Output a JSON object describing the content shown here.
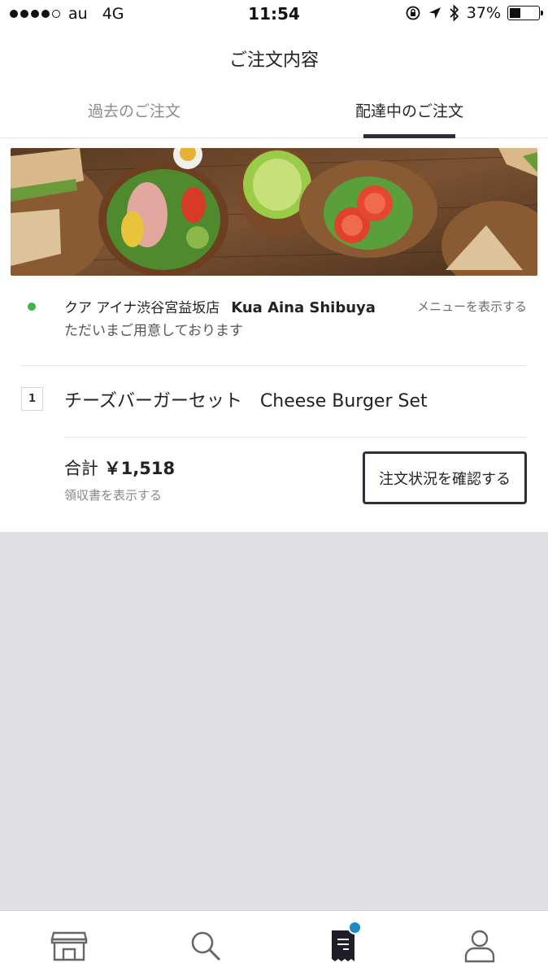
{
  "status_bar": {
    "carrier": "au",
    "network": "4G",
    "time": "11:54",
    "battery": "37%",
    "battery_level": 0.37
  },
  "header": {
    "title": "ご注文内容",
    "tabs": [
      {
        "label": "過去のご注文",
        "active": false
      },
      {
        "label": "配達中のご注文",
        "active": true
      }
    ]
  },
  "order": {
    "banner_icon": "food-photo",
    "store_name_jp": "クア アイナ渋谷宮益坂店",
    "store_name_en": "Kua Aina Shibuya",
    "menu_link": "メニューを表示する",
    "status_text": "ただいまご用意しております",
    "status_color": "#3bb54a",
    "items": [
      {
        "qty": "1",
        "name": "チーズバーガーセット　Cheese Burger Set"
      }
    ],
    "total_label": "合計",
    "total_amount": "￥1,518",
    "receipt_link": "領収書を表示する",
    "status_button": "注文状況を確認する"
  },
  "bottom_nav": {
    "items": [
      {
        "icon": "store-icon"
      },
      {
        "icon": "search-icon"
      },
      {
        "icon": "receipt-icon",
        "badge": true
      },
      {
        "icon": "user-icon"
      }
    ],
    "badge_color": "#1e8bc3"
  }
}
